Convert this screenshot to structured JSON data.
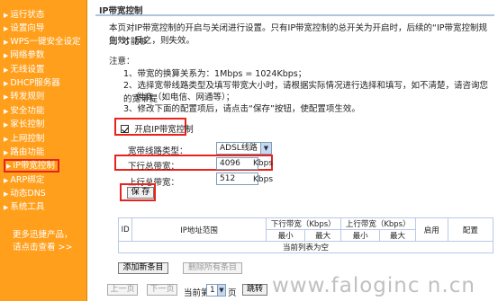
{
  "sidebar": {
    "items": [
      {
        "label": "运行状态"
      },
      {
        "label": "设置向导"
      },
      {
        "label": "WPS一键安全设定"
      },
      {
        "label": "网络参数"
      },
      {
        "label": "无线设置"
      },
      {
        "label": "DHCP服务器"
      },
      {
        "label": "转发规则"
      },
      {
        "label": "安全功能"
      },
      {
        "label": "家长控制"
      },
      {
        "label": "上网控制"
      },
      {
        "label": "路由功能"
      },
      {
        "label": "IP带宽控制"
      },
      {
        "label": "ARP绑定"
      },
      {
        "label": "动态DNS"
      },
      {
        "label": "系统工具"
      }
    ],
    "more_line1": "更多迅捷产品，",
    "more_line2": "请点击查看 >>"
  },
  "main": {
    "title": "IP带宽控制",
    "intro_line1": "本页对IP带宽控制的开启与关闭进行设置。只有IP带宽控制的总开关为开启时，后续的“IP带宽控制规则”才能够",
    "intro_line2": "生效；反之，则失效。",
    "note_label": "注意：",
    "note1": "1、带宽的换算关系为：1Mbps = 1024Kbps；",
    "note2_line1": "2、选择宽带线路类型及填写带宽大小时，请根据实际情况进行选择和填写，如不清楚，请咨询您的宽带提",
    "note2_line2": "供商（如电信、网通等）；",
    "note3": "3、修改下面的配置项后，请点击“保存”按钮，使配置项生效。",
    "enable_label": "开启IP带宽控制",
    "line_type_label": "宽带线路类型：",
    "line_type_value": "ADSL线路",
    "down_label": "下行总带宽：",
    "down_value": "4096",
    "up_label": "上行总带宽：",
    "up_value": "512",
    "unit": "Kbps",
    "save_button": "保 存"
  },
  "table": {
    "col_id": "ID",
    "col_ip": "IP地址范围",
    "col_down": "下行带宽（Kbps）",
    "col_up": "上行带宽（Kbps）",
    "col_min": "最小",
    "col_max": "最大",
    "col_enabled": "启用",
    "col_config": "配置",
    "empty_msg": "当前列表为空"
  },
  "actions": {
    "add": "添加新条目",
    "delete_all": "删除所有条目"
  },
  "pager": {
    "prev": "上一页",
    "next": "下一页",
    "current_label": "当前第",
    "page_value": "1",
    "page_unit": "页",
    "jump": "跳转"
  },
  "watermark": "www.faloginc n.cn"
}
